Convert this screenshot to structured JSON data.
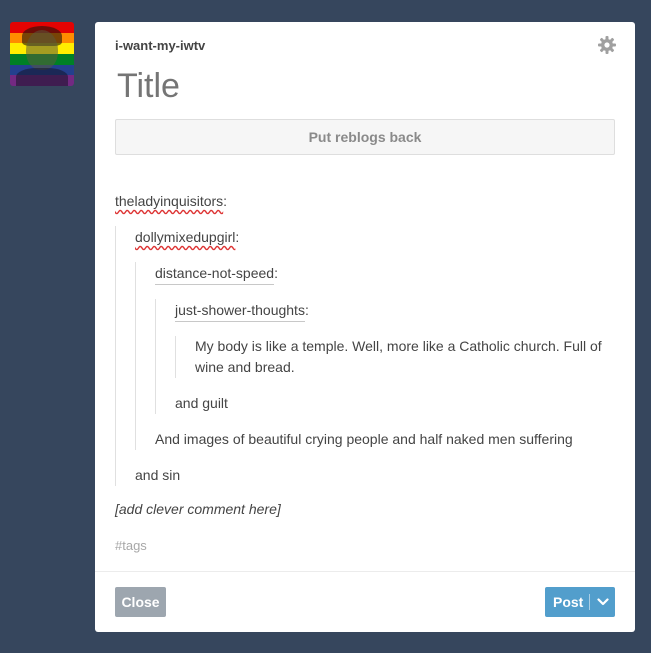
{
  "avatar": {
    "stripes": [
      "#e40303",
      "#ff8c00",
      "#ffed00",
      "#008026",
      "#24408e",
      "#732982"
    ]
  },
  "post": {
    "blog_name": "i-want-my-iwtv",
    "title_placeholder": "Title",
    "reblog_button_label": "Put reblogs back",
    "thread": {
      "user1": "theladyinquisitors",
      "user2": "dollymixedupgirl",
      "user3": "distance-not-speed",
      "user4": "just-shower-thoughts",
      "colon": ":",
      "quote": "My body is like a temple. Well, more like a Catholic church. Full of wine and bread.",
      "reply4": "and guilt",
      "reply3": "And images of beautiful crying people and half naked men suffering",
      "reply2": "and sin"
    },
    "comment_placeholder": "[add clever comment here]",
    "tags_placeholder": "#tags"
  },
  "footer": {
    "close_label": "Close",
    "post_label": "Post"
  },
  "colors": {
    "background": "#36465d",
    "post_button": "#529ecc",
    "close_button": "#9da6af"
  }
}
